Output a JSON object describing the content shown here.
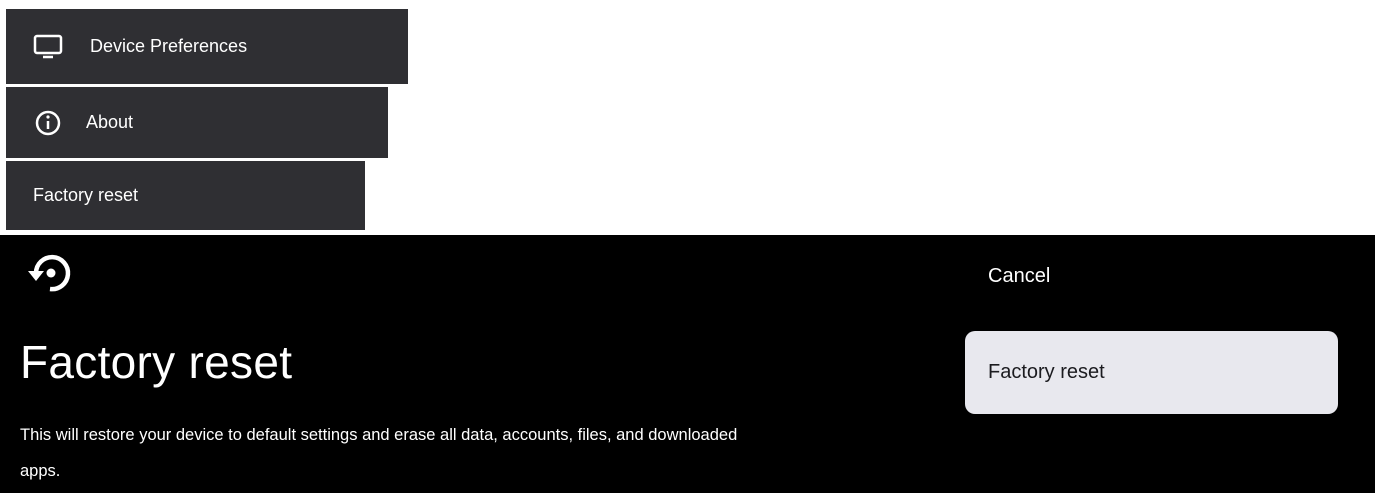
{
  "menu": {
    "items": [
      {
        "label": "Device Preferences",
        "icon": "tv-icon"
      },
      {
        "label": "About",
        "icon": "info-icon"
      },
      {
        "label": "Factory reset"
      }
    ]
  },
  "dialog": {
    "icon": "restore-icon",
    "title": "Factory reset",
    "description": "This will restore your device to default settings and erase all data, accounts, files, and downloaded apps.",
    "cancel_label": "Cancel",
    "confirm_label": "Factory reset"
  },
  "colors": {
    "menu_background": "#2f2f33",
    "dialog_background": "#000000",
    "confirm_button_background": "#e8e8ee"
  }
}
